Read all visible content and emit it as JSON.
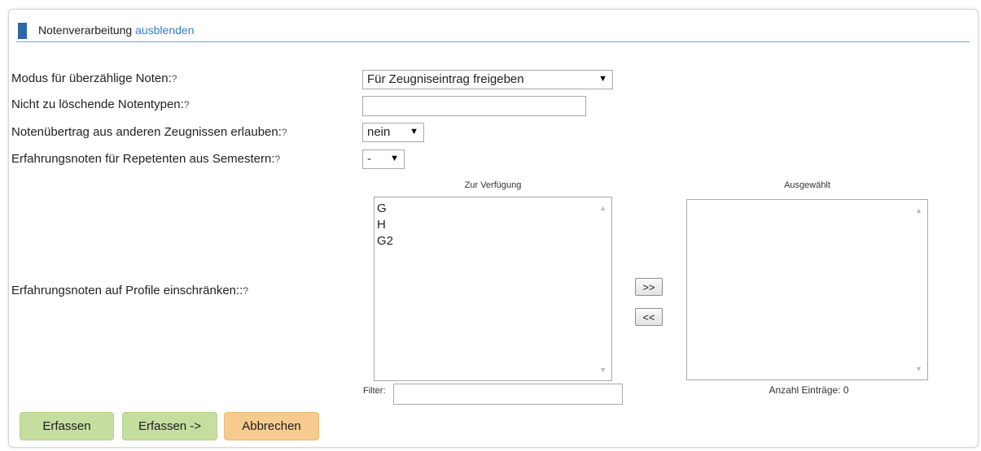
{
  "header": {
    "title": "Notenverarbeitung",
    "toggle_link": "ausblenden"
  },
  "help_mark": "?",
  "fields": {
    "modus": {
      "label": "Modus für überzählige Noten:",
      "value": "Für Zeugniseintrag freigeben",
      "arrow": "▼"
    },
    "notentypen": {
      "label": "Nicht zu löschende Notentypen:",
      "value": ""
    },
    "uebertrag": {
      "label": "Notenübertrag aus anderen Zeugnissen erlauben:",
      "value": "nein",
      "arrow": "▼"
    },
    "repetenten": {
      "label": "Erfahrungsnoten für Repetenten aus Semestern:",
      "value": "-",
      "arrow": "▼"
    },
    "profile": {
      "label": "Erfahrungsnoten auf Profile einschränken::"
    }
  },
  "available": {
    "header": "Zur Verfügung",
    "items": [
      "G",
      "H",
      "G2"
    ],
    "filter_label": "Filter:",
    "filter_value": ""
  },
  "selected": {
    "header": "Ausgewählt",
    "items": [],
    "count_text": "Anzahl Einträge: 0"
  },
  "move_buttons": {
    "add": ">>",
    "remove": "<<"
  },
  "scroll": {
    "up": "▲",
    "down": "▼"
  },
  "actions": {
    "save": "Erfassen",
    "save_next": "Erfassen ->",
    "cancel": "Abbrechen"
  },
  "colors": {
    "header_bar": "#2e67a8",
    "link": "#3a7cc0",
    "green_button": "#c5dea0",
    "orange_button": "#f7cb8f"
  }
}
